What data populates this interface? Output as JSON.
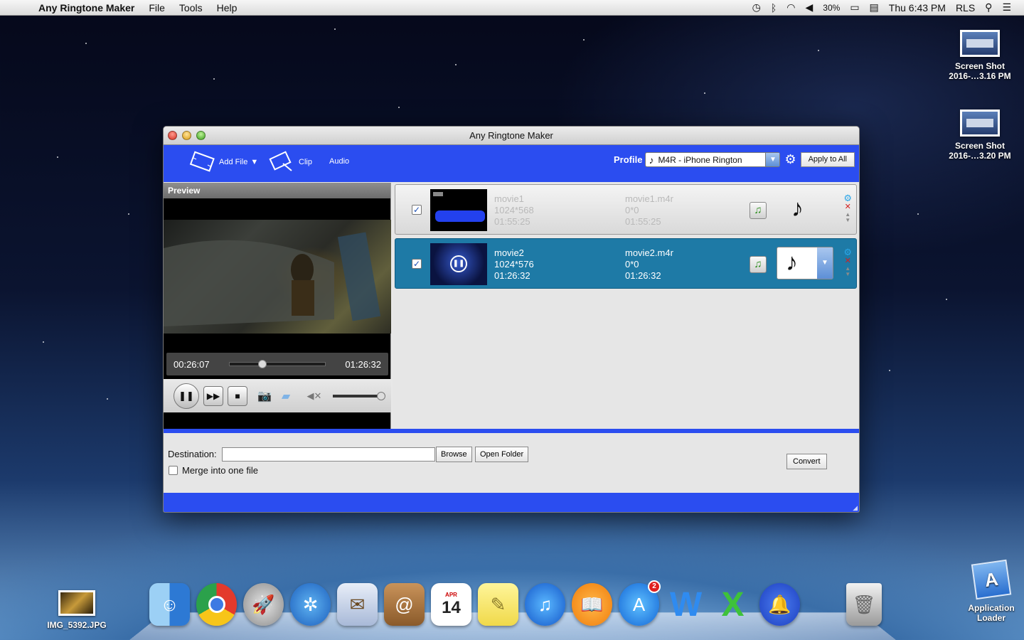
{
  "menubar": {
    "app_name": "Any Ringtone Maker",
    "menus": [
      "File",
      "Tools",
      "Help"
    ],
    "battery": "30%",
    "clock": "Thu 6:43 PM",
    "user": "RLS"
  },
  "desktop": {
    "icons": [
      {
        "line1": "Screen Shot",
        "line2": "2016-…3.16 PM"
      },
      {
        "line1": "Screen Shot",
        "line2": "2016-…3.20 PM"
      }
    ],
    "image_file": "IMG_5392.JPG",
    "app_loader": {
      "line1": "Application",
      "line2": "Loader"
    }
  },
  "window": {
    "title": "Any Ringtone Maker",
    "toolbar": {
      "add_file": "Add File",
      "clip": "Clip",
      "audio": "Audio",
      "profile_label": "Profile",
      "profile_value": "M4R - iPhone Rington",
      "apply_all": "Apply to All"
    },
    "preview": {
      "title": "Preview",
      "current_time": "00:26:07",
      "total_time": "01:26:32",
      "progress": 0.3,
      "volume": 1.0
    },
    "files": [
      {
        "name": "movie1",
        "resolution": "1024*568",
        "duration": "01:55:25",
        "out_name": "movie1.m4r",
        "out_res": "0*0",
        "out_duration": "01:55:25",
        "checked": true,
        "selected": false
      },
      {
        "name": "movie2",
        "resolution": "1024*576",
        "duration": "01:26:32",
        "out_name": "movie2.m4r",
        "out_res": "0*0",
        "out_duration": "01:26:32",
        "checked": true,
        "selected": true
      }
    ],
    "destination": {
      "label": "Destination:",
      "value": "",
      "browse": "Browse",
      "open_folder": "Open Folder",
      "merge": "Merge into one file",
      "convert": "Convert"
    }
  },
  "dock": {
    "items": [
      "finder-icon",
      "chrome-icon",
      "launchpad-icon",
      "safari-icon",
      "mail-icon",
      "contacts-icon",
      "calendar-icon",
      "notes-icon",
      "itunes-icon",
      "ibooks-icon",
      "app-store-icon",
      "word-icon",
      "excel-icon",
      "ringtone-icon",
      "trash-icon"
    ],
    "calendar_month": "APR",
    "calendar_day": "14",
    "app_store_badge": "2"
  },
  "colors": {
    "toolbar_blue": "#2b4df0",
    "selected_row": "#1e7aa6"
  }
}
